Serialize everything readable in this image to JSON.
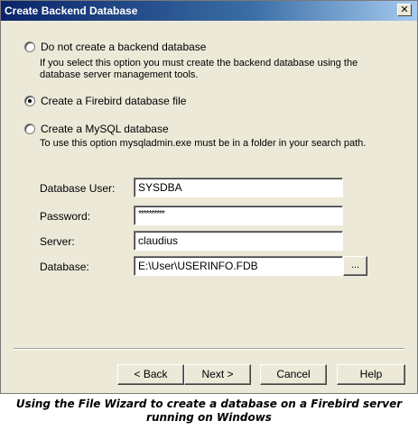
{
  "window": {
    "title": "Create Backend Database",
    "close_glyph": "✕"
  },
  "options": [
    {
      "label": "Do not create a backend database",
      "checked": false,
      "description": "If you select this option you must create the backend database using the database server management tools."
    },
    {
      "label": "Create a Firebird database file",
      "checked": true,
      "description": ""
    },
    {
      "label": "Create a MySQL database",
      "checked": false,
      "description": "To use this option mysqladmin.exe must be in a folder in your search path."
    }
  ],
  "fields": {
    "user": {
      "label": "Database User:",
      "value": "SYSDBA"
    },
    "password": {
      "label": "Password:",
      "value": "**********"
    },
    "server": {
      "label": "Server:",
      "value": "claudius"
    },
    "database": {
      "label": "Database:",
      "value": "E:\\User\\USERINFO.FDB",
      "browse_label": "..."
    }
  },
  "buttons": {
    "back": "< Back",
    "next": "Next >",
    "cancel": "Cancel",
    "help": "Help"
  },
  "caption": "Using the File Wizard to create a database on a Firebird server running on Windows"
}
